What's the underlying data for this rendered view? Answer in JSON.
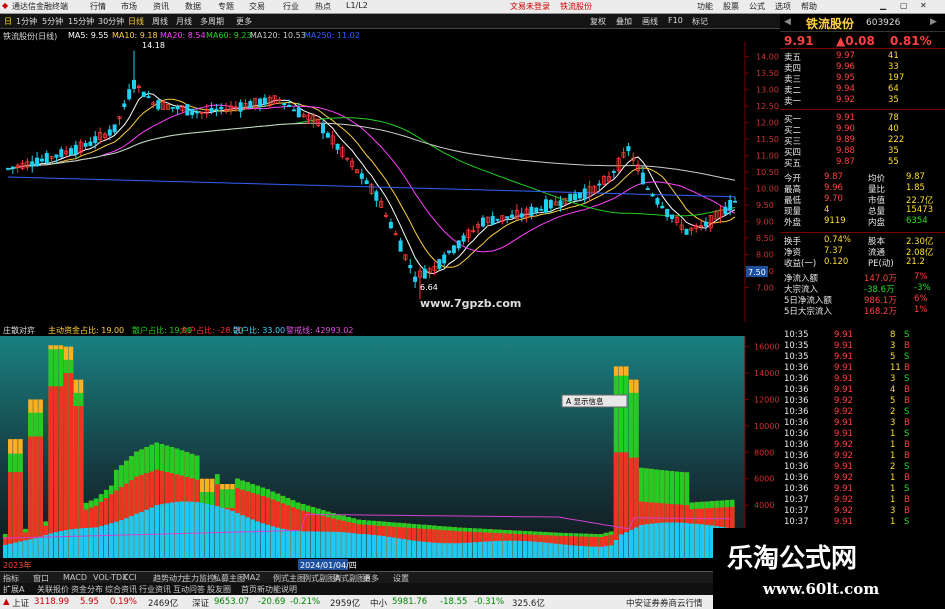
{
  "menubar": {
    "app_title": "通达信金融终端",
    "items": [
      "行情",
      "市场",
      "资讯",
      "数据",
      "专题",
      "交易",
      "行业",
      "热点",
      "L1/L2"
    ],
    "login_trade": "文易未登录",
    "login_quote": "铁流股份",
    "right_items": [
      "功能",
      "股票",
      "公式",
      "选项",
      "帮助"
    ]
  },
  "toolbar": {
    "periods": [
      "日",
      "1分钟",
      "5分钟",
      "15分钟",
      "30分钟",
      "日线",
      "周线",
      "月线",
      "多周期",
      "更多"
    ],
    "tools": [
      "复权",
      "叠加",
      "画线",
      "F10",
      "标记"
    ]
  },
  "ma_line": {
    "stock": "铁流股份(日线)",
    "ma5": "MA5: 9.55",
    "ma10": "MA10: 9.18",
    "ma20": "MA20: 8.54",
    "ma60": "MA60: 9.23",
    "ma120": "MA120: 10.53",
    "ma250": "MA250: 11.02"
  },
  "price_chart": {
    "high_label": "14.18",
    "low_label": "6.64",
    "price_axis": [
      "14.00",
      "13.50",
      "13.00",
      "12.50",
      "12.00",
      "11.50",
      "11.00",
      "10.50",
      "10.00",
      "9.50",
      "9.00",
      "8.50",
      "8.00",
      "7.50",
      "7.00"
    ],
    "current_price_tag": "7.50",
    "site_watermark": "www.7gpzb.com",
    "colors": {
      "up": "#ff3a3a",
      "down": "#20d0f0",
      "ma5": "#ffffff",
      "ma10": "#ffd040",
      "ma20": "#ff40ff",
      "ma60": "#20d020",
      "ma120": "#cccccc",
      "ma250": "#3060ff"
    }
  },
  "indicator_line": {
    "name": "庄散对弈",
    "a": "主动资金占比: 19.00",
    "b": "散户占比: 19.00",
    "c": "大户占比: -28.00",
    "d": "散户比: 33.00",
    "e": "警戒线: 42993.02"
  },
  "indicator_chart": {
    "axis": [
      "16000",
      "14000",
      "12000",
      "10000",
      "8000",
      "6000",
      "4000"
    ],
    "tooltip": "A 显示信息",
    "date_label": "2024/01/04/四",
    "year_label": "2023年"
  },
  "stock_header": {
    "name": "铁流股份",
    "code": "603926"
  },
  "quote": {
    "price": "9.91",
    "change": "▲0.08",
    "pct": "0.81%",
    "asks": [
      {
        "l": "卖五",
        "p": "9.97",
        "v": "41"
      },
      {
        "l": "卖四",
        "p": "9.96",
        "v": "33"
      },
      {
        "l": "卖三",
        "p": "9.95",
        "v": "197"
      },
      {
        "l": "卖二",
        "p": "9.94",
        "v": "64"
      },
      {
        "l": "卖一",
        "p": "9.92",
        "v": "35"
      }
    ],
    "bids": [
      {
        "l": "买一",
        "p": "9.91",
        "v": "78"
      },
      {
        "l": "买二",
        "p": "9.90",
        "v": "40"
      },
      {
        "l": "买三",
        "p": "9.89",
        "v": "222"
      },
      {
        "l": "买四",
        "p": "9.88",
        "v": "35"
      },
      {
        "l": "买五",
        "p": "9.87",
        "v": "55"
      }
    ],
    "stats": [
      {
        "l1": "今开",
        "v1": "9.87",
        "l2": "均价",
        "v2": "9.87"
      },
      {
        "l1": "最高",
        "v1": "9.96",
        "l2": "量比",
        "v2": "1.85"
      },
      {
        "l1": "最低",
        "v1": "9.70",
        "l2": "市值",
        "v2": "22.7亿"
      },
      {
        "l1": "现量",
        "v1": "4",
        "l2": "总量",
        "v2": "15473"
      },
      {
        "l1": "外盘",
        "v1": "9119",
        "l2": "内盘",
        "v2": "6354"
      }
    ],
    "stats2": [
      {
        "l1": "换手",
        "v1": "0.74%",
        "l2": "股本",
        "v2": "2.30亿"
      },
      {
        "l1": "净资",
        "v1": "7.37",
        "l2": "流通",
        "v2": "2.08亿"
      },
      {
        "l1": "收益(一)",
        "v1": "0.120",
        "l2": "PE(动)",
        "v2": "21.2"
      }
    ],
    "flows": [
      {
        "l": "净流入额",
        "v": "147.0万",
        "p": "7%"
      },
      {
        "l": "大宗流入",
        "v": "-38.6万",
        "p": "-3%"
      },
      {
        "l": "5日净流入额",
        "v": "986.1万",
        "p": "6%"
      },
      {
        "l": "5日大宗流入",
        "v": "168.2万",
        "p": "1%"
      }
    ]
  },
  "ticks": [
    {
      "t": "10:35",
      "p": "9.91",
      "v": "8",
      "f": "S"
    },
    {
      "t": "10:35",
      "p": "9.91",
      "v": "3",
      "f": "B"
    },
    {
      "t": "10:35",
      "p": "9.91",
      "v": "5",
      "f": "S"
    },
    {
      "t": "10:36",
      "p": "9.91",
      "v": "11",
      "f": "B"
    },
    {
      "t": "10:36",
      "p": "9.91",
      "v": "3",
      "f": "S"
    },
    {
      "t": "10:36",
      "p": "9.91",
      "v": "4",
      "f": "B"
    },
    {
      "t": "10:36",
      "p": "9.92",
      "v": "5",
      "f": "B"
    },
    {
      "t": "10:36",
      "p": "9.92",
      "v": "2",
      "f": "S"
    },
    {
      "t": "10:36",
      "p": "9.91",
      "v": "3",
      "f": "B"
    },
    {
      "t": "10:36",
      "p": "9.91",
      "v": "1",
      "f": "S"
    },
    {
      "t": "10:36",
      "p": "9.92",
      "v": "1",
      "f": "B"
    },
    {
      "t": "10:36",
      "p": "9.92",
      "v": "1",
      "f": "B"
    },
    {
      "t": "10:36",
      "p": "9.91",
      "v": "2",
      "f": "S"
    },
    {
      "t": "10:36",
      "p": "9.92",
      "v": "1",
      "f": "B"
    },
    {
      "t": "10:36",
      "p": "9.91",
      "v": "1",
      "f": "S"
    },
    {
      "t": "10:37",
      "p": "9.92",
      "v": "1",
      "f": "B"
    },
    {
      "t": "10:37",
      "p": "9.92",
      "v": "3",
      "f": "B"
    },
    {
      "t": "10:37",
      "p": "9.91",
      "v": "1",
      "f": "S"
    }
  ],
  "bottom_tabs": [
    "指标",
    "窗口",
    "MACD",
    "VOL-TDX",
    "CCI",
    "趋势动力",
    "主力监控",
    "私募主图",
    "MA2",
    "例式主图",
    "例式副图A",
    "例式副图B",
    "更多",
    "设置"
  ],
  "bottom_tabs2": [
    "扩展A",
    "关联报价",
    "资金分布",
    "综合资讯",
    "行业资讯",
    "互动问答",
    "股友圈",
    "首页新功能说明"
  ],
  "statusbar": {
    "idx1_name": "上证",
    "idx1_val": "3118.99",
    "idx1_chg": "5.95",
    "idx1_pct": "0.19%",
    "idx1_amt": "2469亿",
    "idx2_name": "深证",
    "idx2_val": "9653.07",
    "idx2_chg": "-20.69",
    "idx2_pct": "-0.21%",
    "idx2_amt": "2959亿",
    "idx3_name": "中小",
    "idx3_val": "5981.76",
    "idx3_chg": "-18.55",
    "idx3_pct": "-0.31%",
    "idx3_amt": "325.6亿",
    "right": "中安证券券商云行情"
  },
  "watermark": {
    "title": "乐淘公式网",
    "url": "www.60lt.com"
  }
}
